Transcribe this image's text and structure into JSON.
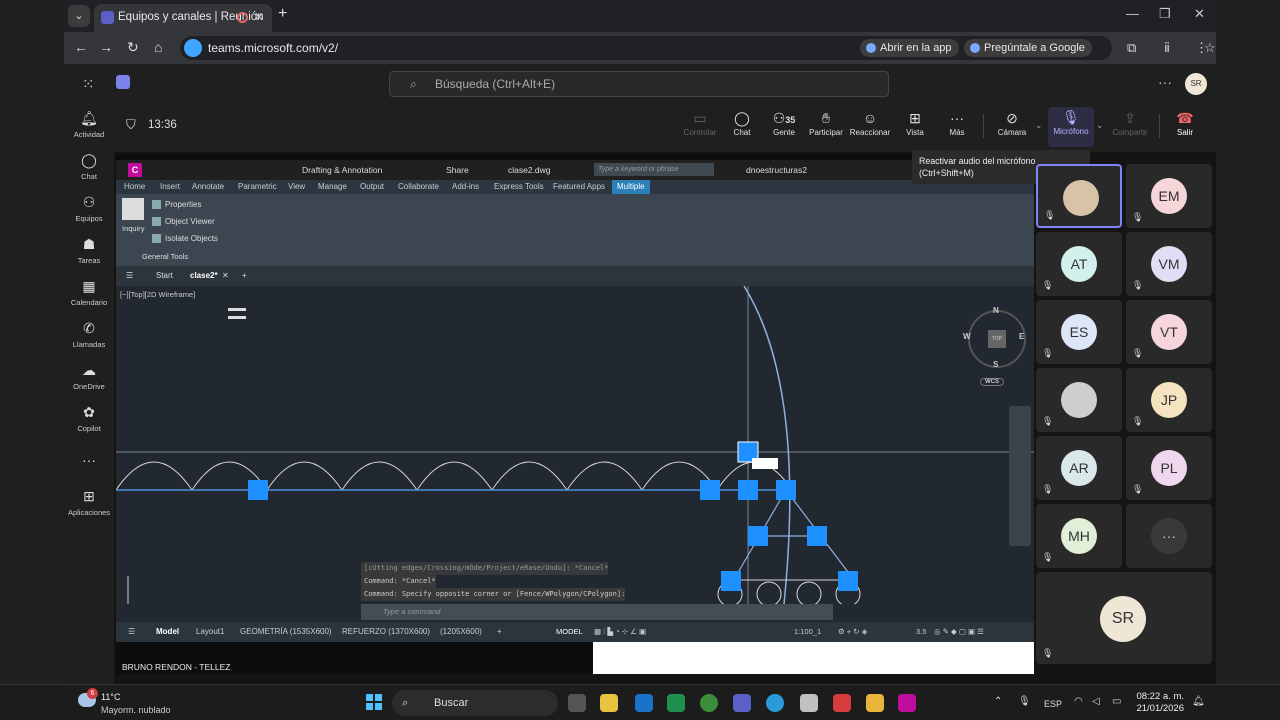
{
  "browser": {
    "tab_title": "Equipos y canales | Reunión",
    "url": "teams.microsoft.com/v2/",
    "open_in_app": "Abrir en la app",
    "ask_google": "Pregúntale a Google"
  },
  "teams": {
    "search_placeholder": "Búsqueda (Ctrl+Alt+E)",
    "user_initials": "SR",
    "rail": [
      {
        "label": "Actividad",
        "icon": "bell-icon"
      },
      {
        "label": "Chat",
        "icon": "chat-icon"
      },
      {
        "label": "Equipos",
        "icon": "teams-icon"
      },
      {
        "label": "Tareas",
        "icon": "tasks-icon"
      },
      {
        "label": "Calendario",
        "icon": "calendar-icon"
      },
      {
        "label": "Llamadas",
        "icon": "phone-icon"
      },
      {
        "label": "OneDrive",
        "icon": "cloud-icon"
      },
      {
        "label": "Copilot",
        "icon": "copilot-icon"
      },
      {
        "label": "",
        "icon": "more-icon"
      },
      {
        "label": "Aplicaciones",
        "icon": "apps-icon"
      }
    ]
  },
  "meeting": {
    "time": "13:36",
    "controls": {
      "share_control": "Controlar",
      "chat": "Chat",
      "people": "Gente",
      "people_count": "35",
      "raise": "Participar",
      "react": "Reaccionar",
      "view": "Vista",
      "more": "Más",
      "camera": "Cámara",
      "mic": "Micrófono",
      "share": "Compartir",
      "leave": "Salir"
    },
    "tooltip_line1": "Reactivar audio del micrófono",
    "tooltip_line2": "(Ctrl+Shift+M)",
    "presenter": "BRUNO RENDON - TELLEZ",
    "participants": [
      {
        "initials": "",
        "photo": true,
        "color": "#d8c2a8",
        "active": true
      },
      {
        "initials": "EM",
        "color": "#f6d6d8"
      },
      {
        "initials": "AT",
        "color": "#d4f0ec"
      },
      {
        "initials": "VM",
        "color": "#e3dcf5"
      },
      {
        "initials": "ES",
        "color": "#dce6f6"
      },
      {
        "initials": "VT",
        "color": "#f6d6dc"
      },
      {
        "initials": "",
        "photo": true,
        "color": "#cfcfcf"
      },
      {
        "initials": "JP",
        "color": "#f6e3c0"
      },
      {
        "initials": "AR",
        "color": "#dbe8ea"
      },
      {
        "initials": "PL",
        "color": "#efd8ee"
      },
      {
        "initials": "MH",
        "color": "#e2efd8"
      },
      {
        "initials": "···",
        "color": "#3a3a3a"
      }
    ],
    "self_initials": "SR"
  },
  "autocad": {
    "workspace": "Drafting & Annotation",
    "share": "Share",
    "filename": "clase2.dwg",
    "search_placeholder": "Type a keyword or phrase",
    "user": "dnoestructuras2",
    "ribbon_tabs": [
      "Home",
      "Insert",
      "Annotate",
      "Parametric",
      "View",
      "Manage",
      "Output",
      "Collaborate",
      "Add-ins",
      "Express Tools",
      "Featured Apps",
      "Multiple"
    ],
    "ribbon_items": [
      "Properties",
      "Object Viewer",
      "Isolate Objects"
    ],
    "inquiry": "Inquiry",
    "general_tools": "General Tools",
    "doc_tabs": [
      "Start",
      "clase2*"
    ],
    "view_label": "[−][Top][2D Wireframe]",
    "cmd_history": [
      "[cUtting edges/Crossing/mOde/Project/eRase/Undo]: *Cancel*",
      "Command: *Cancel*",
      "Command: Specify opposite corner or [Fence/WPolygon/CPolygon]:"
    ],
    "cmd_placeholder": "Type a command",
    "layout_tabs": [
      "Model",
      "Layout1",
      "GEOMETRÍA (1535X600)",
      "REFUERZO (1370X600)",
      "(1205X600)"
    ],
    "status_model": "MODEL",
    "scale": "1:100_1",
    "zoom": "3.5",
    "compass": {
      "n": "N",
      "s": "S",
      "e": "E",
      "w": "W",
      "top": "TOP",
      "wcs": "WCS"
    }
  },
  "taskbar": {
    "temp": "11°C",
    "condition": "Mayorm. nublado",
    "notif": "6",
    "search": "Buscar",
    "lang": "ESP",
    "time": "08:22 a. m.",
    "date": "21/01/2026"
  }
}
